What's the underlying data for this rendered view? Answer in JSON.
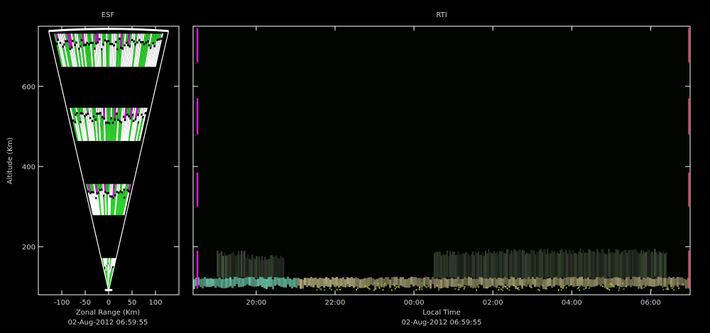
{
  "colors": {
    "background": "#000000",
    "axis": "#ffffff",
    "text": "#cfcfcf",
    "green": "#2fd12f",
    "magenta": "#d61ad6",
    "pink": "#ff4d6d"
  },
  "chart_data": [
    {
      "type": "scatter",
      "panel": "ESF",
      "title": "ESF",
      "xlabel": "Zonal Range (Km)",
      "ylabel": "Altitude (Km)",
      "footer": "02-Aug-2012 06:59:55",
      "xlim": [
        -150,
        150
      ],
      "ylim": [
        80,
        750
      ],
      "xticks": [
        -100,
        -50,
        0,
        50,
        100
      ],
      "yticks": [
        200,
        400,
        600
      ],
      "fan": {
        "apex_altitude": 90,
        "top_altitude": 738,
        "half_width_at_top": 128
      },
      "echo_bands": [
        {
          "altitude_from": 90,
          "altitude_to": 175
        },
        {
          "altitude_from": 275,
          "altitude_to": 360
        },
        {
          "altitude_from": 460,
          "altitude_to": 550
        },
        {
          "altitude_from": 645,
          "altitude_to": 735
        }
      ]
    },
    {
      "type": "heatmap",
      "panel": "RTI",
      "title": "RTI",
      "xlabel": "Local Time",
      "footer": "02-Aug-2012 06:59:55",
      "xlim": [
        18.4,
        31.0
      ],
      "ylim": [
        80,
        750
      ],
      "xticks": [
        20,
        22,
        24,
        26,
        28,
        30
      ],
      "xtick_labels": [
        "20:00",
        "22:00",
        "00:00",
        "02:00",
        "04:00",
        "06:00"
      ],
      "yticks": [
        200,
        400,
        600
      ],
      "markers_left": [
        {
          "altitude_from": 95,
          "altitude_to": 190,
          "color": "magenta"
        },
        {
          "altitude_from": 300,
          "altitude_to": 385,
          "color": "magenta"
        },
        {
          "altitude_from": 480,
          "altitude_to": 570,
          "color": "magenta"
        },
        {
          "altitude_from": 660,
          "altitude_to": 745,
          "color": "magenta"
        }
      ],
      "layer": {
        "altitude_base": 100,
        "altitude_top": 125
      },
      "spread_f_patches": [
        {
          "t_from": 19.0,
          "t_to": 19.7,
          "altitude_to": 190,
          "intensity": 0.55
        },
        {
          "t_from": 19.7,
          "t_to": 20.7,
          "altitude_to": 180,
          "intensity": 0.35
        },
        {
          "t_from": 24.5,
          "t_to": 25.8,
          "altitude_to": 190,
          "intensity": 0.3
        },
        {
          "t_from": 25.8,
          "t_to": 27.3,
          "altitude_to": 195,
          "intensity": 0.35
        },
        {
          "t_from": 27.3,
          "t_to": 29.8,
          "altitude_to": 195,
          "intensity": 0.3
        },
        {
          "t_from": 29.8,
          "t_to": 30.4,
          "altitude_to": 195,
          "intensity": 0.5
        }
      ]
    }
  ]
}
